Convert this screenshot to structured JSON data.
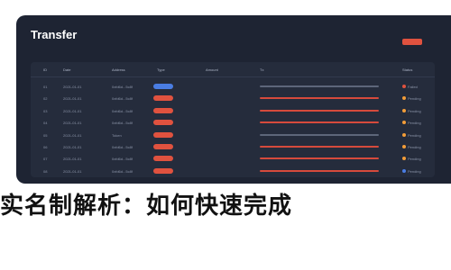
{
  "window": {
    "title": "Transfer"
  },
  "table": {
    "headers": [
      "ID",
      "Date",
      "Address",
      "Type",
      "Amount",
      "Tx",
      "Status"
    ],
    "rows": [
      {
        "id": "01",
        "date": "2021-01-01",
        "address": "0xfd6d...5c8f",
        "type": "transfer",
        "tx_color": "grey",
        "status": "Failed",
        "status_color": "red"
      },
      {
        "id": "02",
        "date": "2021-01-01",
        "address": "0xfd6d...5c8f",
        "type": "transfer",
        "tx_color": "red",
        "status": "Pending",
        "status_color": "orange"
      },
      {
        "id": "03",
        "date": "2021-01-01",
        "address": "0xfd6d...5c8f",
        "type": "transfer",
        "tx_color": "red",
        "status": "Pending",
        "status_color": "orange"
      },
      {
        "id": "04",
        "date": "2021-01-01",
        "address": "0xfd6d...5c8f",
        "type": "transfer",
        "tx_color": "red",
        "status": "Pending",
        "status_color": "orange"
      },
      {
        "id": "05",
        "date": "2021-01-01",
        "address": "Token",
        "type": "transfer",
        "tx_color": "grey",
        "status": "Pending",
        "status_color": "orange"
      },
      {
        "id": "06",
        "date": "2021-01-01",
        "address": "0xfd6d...5c8f",
        "type": "transfer",
        "tx_color": "red",
        "status": "Pending",
        "status_color": "orange"
      },
      {
        "id": "07",
        "date": "2021-01-01",
        "address": "0xfd6d...5c8f",
        "type": "transfer",
        "tx_color": "red",
        "status": "Pending",
        "status_color": "orange"
      },
      {
        "id": "08",
        "date": "2021-01-01",
        "address": "0xfd6d...5c8f",
        "type": "transfer",
        "tx_color": "red",
        "status": "Pending",
        "status_color": "blue"
      }
    ]
  },
  "headline": "实名制解析：如何快速完成"
}
